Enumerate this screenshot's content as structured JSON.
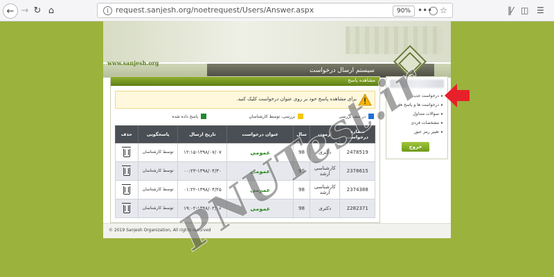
{
  "browser": {
    "url": "request.sanjesh.org/noetrequest/Users/Answer.aspx",
    "zoom": "90%"
  },
  "header": {
    "site_url": "www.sanjesh.org",
    "system_title": "سیستم ارسال درخواست"
  },
  "main": {
    "panel_title": "مشاهده پاسخ",
    "alert_text": "برای مشاهده پاسخ خود بر روی عنوان درخواست کلیک کنید.",
    "legend": [
      {
        "label": "در صف بررسی",
        "color": "#1d6fd8"
      },
      {
        "label": "بررسی، توسط کارشناسان",
        "color": "#f2c811"
      },
      {
        "label": "پاسخ داده شده",
        "color": "#1f8a2a"
      }
    ],
    "columns": [
      "شماره درخواست",
      "آزمون",
      "سال",
      "عنوان درخواست",
      "تاریخ ارسال",
      "پاسخگویی",
      "حذف"
    ],
    "rows": [
      {
        "number": "2478519",
        "exam": "دکتری",
        "year": "98",
        "topic": "عمومی",
        "date": "۱۲:۱۵-۱۳۹۸/۰۷/۰۷",
        "responder": "توسط کارشناسان"
      },
      {
        "number": "2378615",
        "exam": "کارشناسی ارشد",
        "year": "98",
        "topic": "عمومی",
        "date": "۰۰:۲۳-۱۳۹۸/۰۴/۳۰",
        "responder": "توسط کارشناسان"
      },
      {
        "number": "2374388",
        "exam": "کارشناسی ارشد",
        "year": "98",
        "topic": "عمومی",
        "date": "۰۱:۲۲-۱۳۹۸/۰۴/۲۵",
        "responder": "توسط کارشناسان"
      },
      {
        "number": "2282371",
        "exam": "دکتری",
        "year": "98",
        "topic": "عمومی",
        "date": "۱۹:۰۲-۱۳۹۸/۰۳/۱۶",
        "responder": "توسط کارشناسان"
      }
    ]
  },
  "sidebar": {
    "items": [
      "درخواست جدید",
      "درخواست ها و پاسخ ها",
      "سوالات متداول",
      "مشخصات فردی",
      "تغییر رمز عبور"
    ],
    "exit_label": "خروج"
  },
  "footer": {
    "text": "© 2019 Sanjesh Organization, All rights reserved"
  },
  "watermark": "PNUTest.ir",
  "colors": {
    "background": "#9bb23c",
    "header_green": "#6f9a1a",
    "topic_green": "#2b8a1e",
    "arrow": "#e8202a"
  }
}
